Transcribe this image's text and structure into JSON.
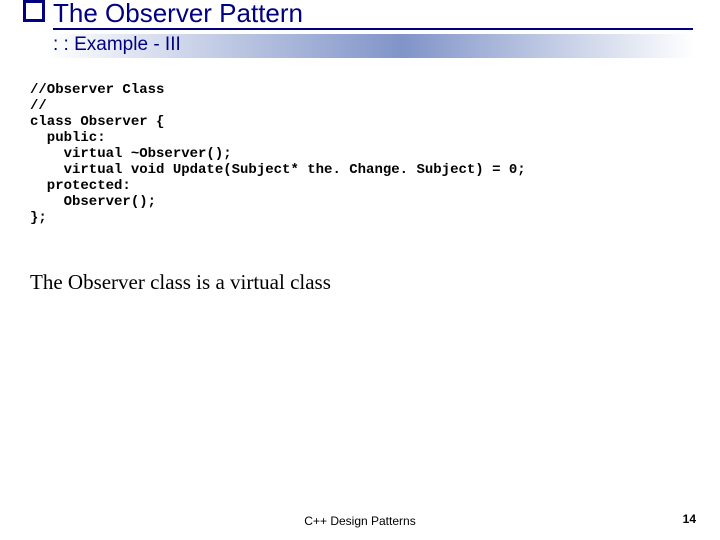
{
  "title": "The Observer Pattern",
  "subtitle": ": : Example - III",
  "code": "//Observer Class\n//\nclass Observer {\n  public:\n    virtual ~Observer();\n    virtual void Update(Subject* the. Change. Subject) = 0;\n  protected:\n    Observer();\n};",
  "body": "The Observer class is a virtual class",
  "footer_center": "C++ Design Patterns",
  "page_number": "14"
}
